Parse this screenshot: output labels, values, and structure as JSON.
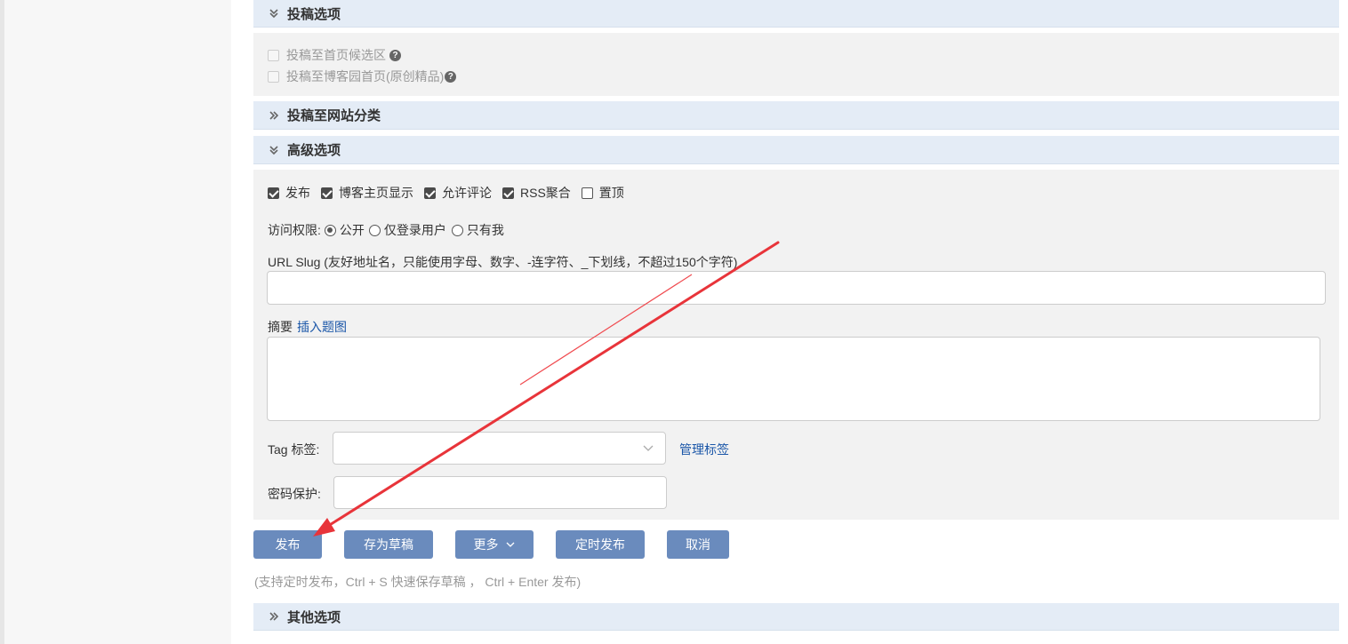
{
  "sections": {
    "submit_options": {
      "title": "投稿选项",
      "items": [
        {
          "label": "投稿至首页候选区",
          "checked": false,
          "disabled": true
        },
        {
          "label": "投稿至博客园首页(原创精品)",
          "checked": false,
          "disabled": true
        }
      ]
    },
    "site_category": {
      "title": "投稿至网站分类"
    },
    "advanced": {
      "title": "高级选项",
      "checkboxes": [
        {
          "label": "发布",
          "checked": true
        },
        {
          "label": "博客主页显示",
          "checked": true
        },
        {
          "label": "允许评论",
          "checked": true
        },
        {
          "label": "RSS聚合",
          "checked": true
        },
        {
          "label": "置顶",
          "checked": false
        }
      ],
      "access": {
        "label": "访问权限:",
        "options": [
          {
            "label": "公开",
            "selected": true
          },
          {
            "label": "仅登录用户",
            "selected": false
          },
          {
            "label": "只有我",
            "selected": false
          }
        ]
      },
      "url_slug": {
        "label": "URL Slug (友好地址名，只能使用字母、数字、-连字符、_下划线，不超过150个字符)",
        "value": ""
      },
      "summary": {
        "label": "摘要",
        "insert_link": "插入题图",
        "value": ""
      },
      "tag": {
        "label": "Tag 标签:",
        "value": "",
        "manage_link": "管理标签"
      },
      "password": {
        "label": "密码保护:",
        "value": ""
      }
    },
    "other": {
      "title": "其他选项"
    }
  },
  "actions": {
    "publish": "发布",
    "save_draft": "存为草稿",
    "more": "更多",
    "schedule": "定时发布",
    "cancel": "取消"
  },
  "hint": "(支持定时发布，Ctrl + S 快速保存草稿 ， Ctrl + Enter 发布)",
  "colors": {
    "button": "#6a8bbd",
    "section_header": "#e4ecf6",
    "panel": "#f2f2f2",
    "link": "#1a56a8",
    "annotation_arrow": "#e8343a"
  }
}
